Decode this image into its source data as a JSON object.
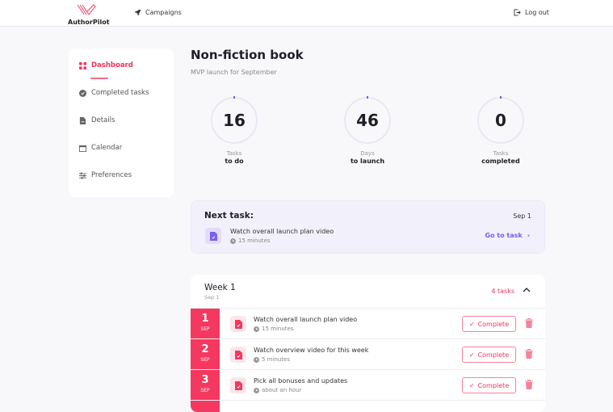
{
  "header": {
    "logo_text": "AuthorPilot",
    "campaigns": "Campaigns",
    "logout": "Log out"
  },
  "sidebar": {
    "items": [
      {
        "label": "Dashboard",
        "icon": "grid-icon",
        "active": true
      },
      {
        "label": "Completed tasks",
        "icon": "check-circle-icon"
      },
      {
        "label": "Details",
        "icon": "document-icon"
      },
      {
        "label": "Calendar",
        "icon": "calendar-icon"
      },
      {
        "label": "Preferences",
        "icon": "sliders-icon"
      }
    ]
  },
  "main": {
    "title": "Non-fiction book",
    "subtitle": "MVP launch for September",
    "stats": [
      {
        "value": "16",
        "line1": "Tasks",
        "line2": "to do"
      },
      {
        "value": "46",
        "line1": "Days",
        "line2": "to launch"
      },
      {
        "value": "0",
        "line1": "Tasks",
        "line2": "completed"
      }
    ],
    "next_task": {
      "heading": "Next task:",
      "date": "Sep 1",
      "title": "Watch overall launch plan video",
      "duration": "15 minutes",
      "go_label": "Go to task"
    },
    "week": {
      "title": "Week 1",
      "date": "Sep 1",
      "count": "4 tasks",
      "tasks": [
        {
          "day": "1",
          "month": "SEP",
          "title": "Watch overall launch plan video",
          "duration": "15 minutes",
          "action": "Complete"
        },
        {
          "day": "2",
          "month": "SEP",
          "title": "Watch overview video for this week",
          "duration": "5 minutes",
          "action": "Complete"
        },
        {
          "day": "3",
          "month": "SEP",
          "title": "Pick all bonuses and updates",
          "duration": "about an hour",
          "action": "Complete"
        }
      ]
    }
  },
  "colors": {
    "accent": "#f5385f",
    "purple": "#7b5cf5"
  }
}
